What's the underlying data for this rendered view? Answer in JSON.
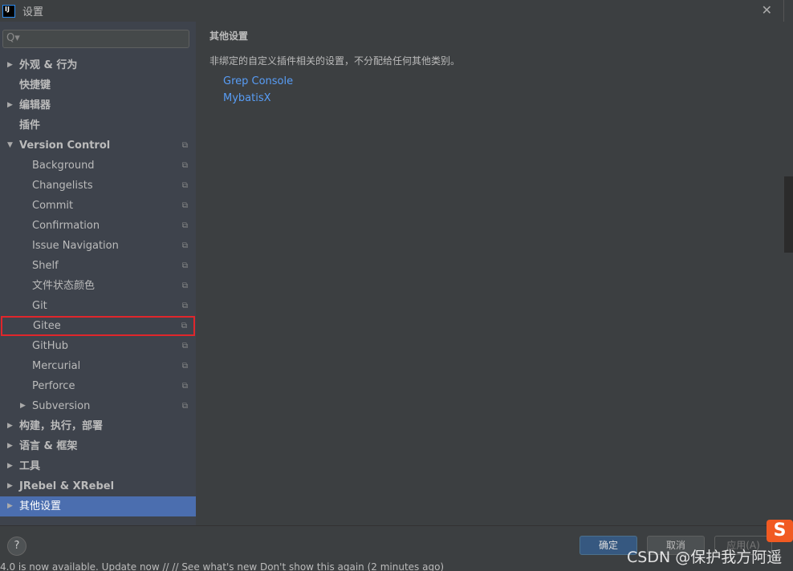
{
  "window": {
    "title": "设置",
    "app_icon": "IJ"
  },
  "search": {
    "placeholder": "Q▾"
  },
  "tree": [
    {
      "label": "外观 & 行为",
      "level": 0,
      "arrow": "▶",
      "bold": true
    },
    {
      "label": "快捷键",
      "level": 0,
      "bold": true
    },
    {
      "label": "编辑器",
      "level": 0,
      "arrow": "▶",
      "bold": true
    },
    {
      "label": "插件",
      "level": 0,
      "bold": true
    },
    {
      "label": "Version Control",
      "level": 0,
      "arrow": "▼",
      "bold": true,
      "copy": true
    },
    {
      "label": "Background",
      "level": 1,
      "copy": true
    },
    {
      "label": "Changelists",
      "level": 1,
      "copy": true
    },
    {
      "label": "Commit",
      "level": 1,
      "copy": true
    },
    {
      "label": "Confirmation",
      "level": 1,
      "copy": true
    },
    {
      "label": "Issue Navigation",
      "level": 1,
      "copy": true
    },
    {
      "label": "Shelf",
      "level": 1,
      "copy": true
    },
    {
      "label": "文件状态颜色",
      "level": 1,
      "copy": true
    },
    {
      "label": "Git",
      "level": 1,
      "copy": true
    },
    {
      "label": "Gitee",
      "level": 1,
      "copy": true,
      "highlighted": true
    },
    {
      "label": "GitHub",
      "level": 1,
      "copy": true
    },
    {
      "label": "Mercurial",
      "level": 1,
      "copy": true
    },
    {
      "label": "Perforce",
      "level": 1,
      "copy": true
    },
    {
      "label": "Subversion",
      "level": 1,
      "arrow": "▶",
      "copy": true
    },
    {
      "label": "构建，执行，部署",
      "level": 0,
      "arrow": "▶",
      "bold": true
    },
    {
      "label": "语言 & 框架",
      "level": 0,
      "arrow": "▶",
      "bold": true
    },
    {
      "label": "工具",
      "level": 0,
      "arrow": "▶",
      "bold": true
    },
    {
      "label": "JRebel & XRebel",
      "level": 0,
      "arrow": "▶",
      "bold": true
    },
    {
      "label": "其他设置",
      "level": 0,
      "arrow": "▶",
      "selected": true
    }
  ],
  "main": {
    "title": "其他设置",
    "description": "非绑定的自定义插件相关的设置，不分配给任何其他类别。",
    "links": [
      "Grep Console",
      "MybatisX"
    ]
  },
  "footer": {
    "help": "?",
    "ok": "确定",
    "cancel": "取消",
    "apply": "应用(A)"
  },
  "statusbar": "4.0 is now available. Update now // // See what's new    Don't show this again (2 minutes ago)",
  "watermark": "CSDN @保护我方阿遥",
  "colors": {
    "selection": "#4b6eaf",
    "link": "#589df6",
    "highlight_box": "#e0262b"
  }
}
